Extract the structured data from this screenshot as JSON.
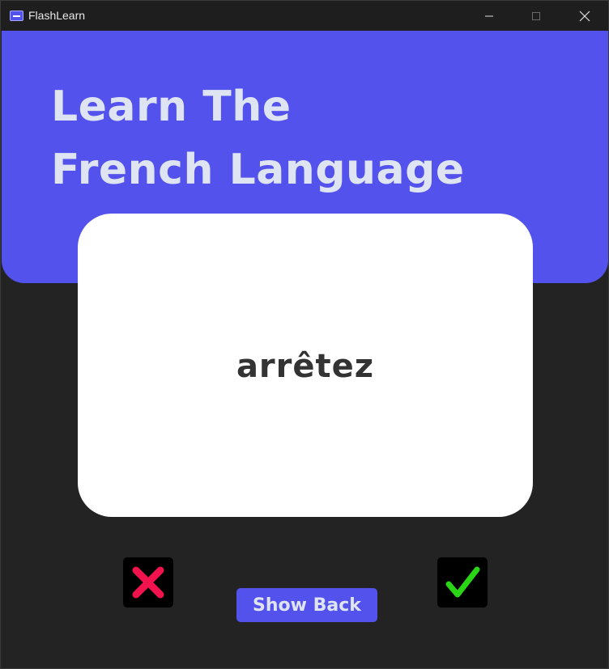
{
  "window": {
    "title": "FlashLearn",
    "icon": "flashcard-app-icon",
    "controls": [
      "minimize-icon",
      "maximize-icon",
      "close-icon"
    ]
  },
  "header": {
    "line1": "Learn The",
    "line2": "French Language"
  },
  "card": {
    "word": "arrêtez"
  },
  "actions": {
    "wrong_icon": "cross-icon",
    "right_icon": "check-icon",
    "show_back_label": "Show Back"
  },
  "colors": {
    "accent": "#5352ed",
    "background": "#232323",
    "card": "#ffffff",
    "heading_text": "#dfe4f3",
    "wrong": "#f0134d",
    "right": "#2ad515"
  }
}
